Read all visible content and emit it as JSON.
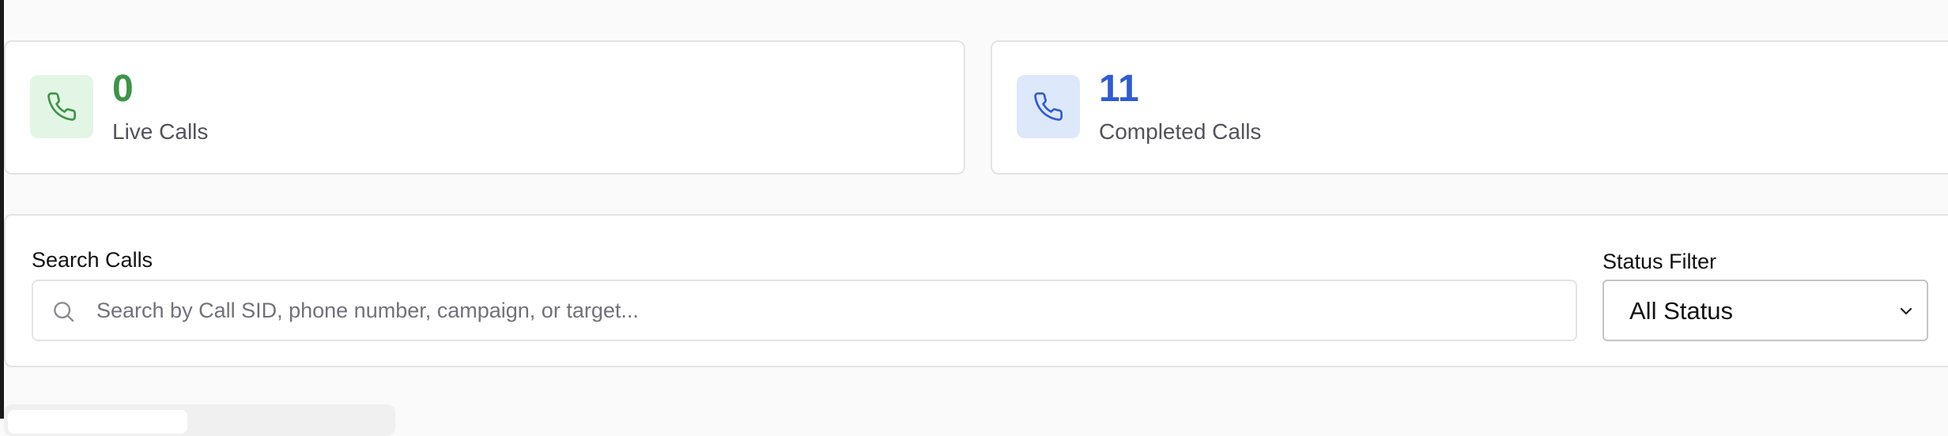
{
  "stats": {
    "live": {
      "value": "0",
      "label": "Live Calls",
      "icon": "phone-icon",
      "color": "#3d9447",
      "icon_bg": "#e3f6e6"
    },
    "completed": {
      "value": "11",
      "label": "Completed Calls",
      "icon": "phone-icon",
      "color": "#2f5bd3",
      "icon_bg": "#dde8fb"
    }
  },
  "filters": {
    "search": {
      "label": "Search Calls",
      "placeholder": "Search by Call SID, phone number, campaign, or target...",
      "value": "",
      "icon": "search-icon"
    },
    "status": {
      "label": "Status Filter",
      "selected": "All Status",
      "icon": "chevron-down-icon"
    }
  }
}
